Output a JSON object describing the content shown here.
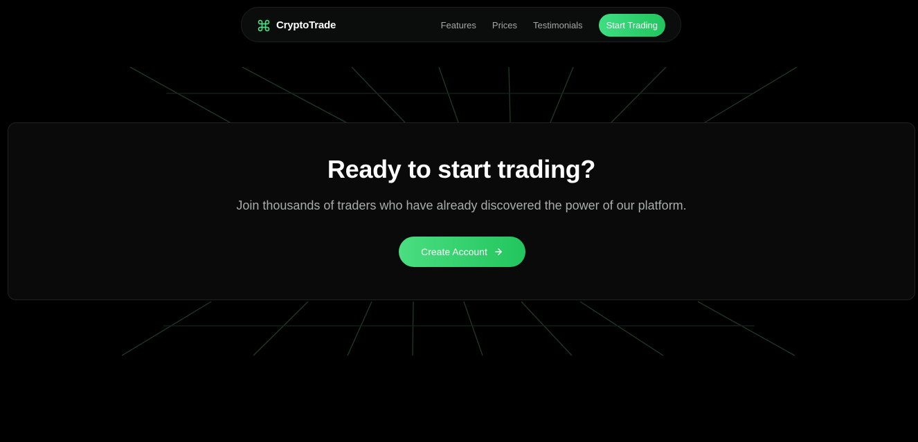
{
  "navbar": {
    "brand_name": "CryptoTrade",
    "brand_icon": "command-icon",
    "links": [
      "Features",
      "Prices",
      "Testimonials"
    ],
    "cta_label": "Start Trading"
  },
  "cta": {
    "title": "Ready to start trading?",
    "subtitle": "Join thousands of traders who have already discovered the power of our platform.",
    "button_label": "Create Account",
    "button_icon": "arrow-right-icon"
  },
  "colors": {
    "accent": "#22c55e",
    "accent_light": "#4ade80",
    "background": "#000000",
    "card_background": "#0a0a0a"
  }
}
